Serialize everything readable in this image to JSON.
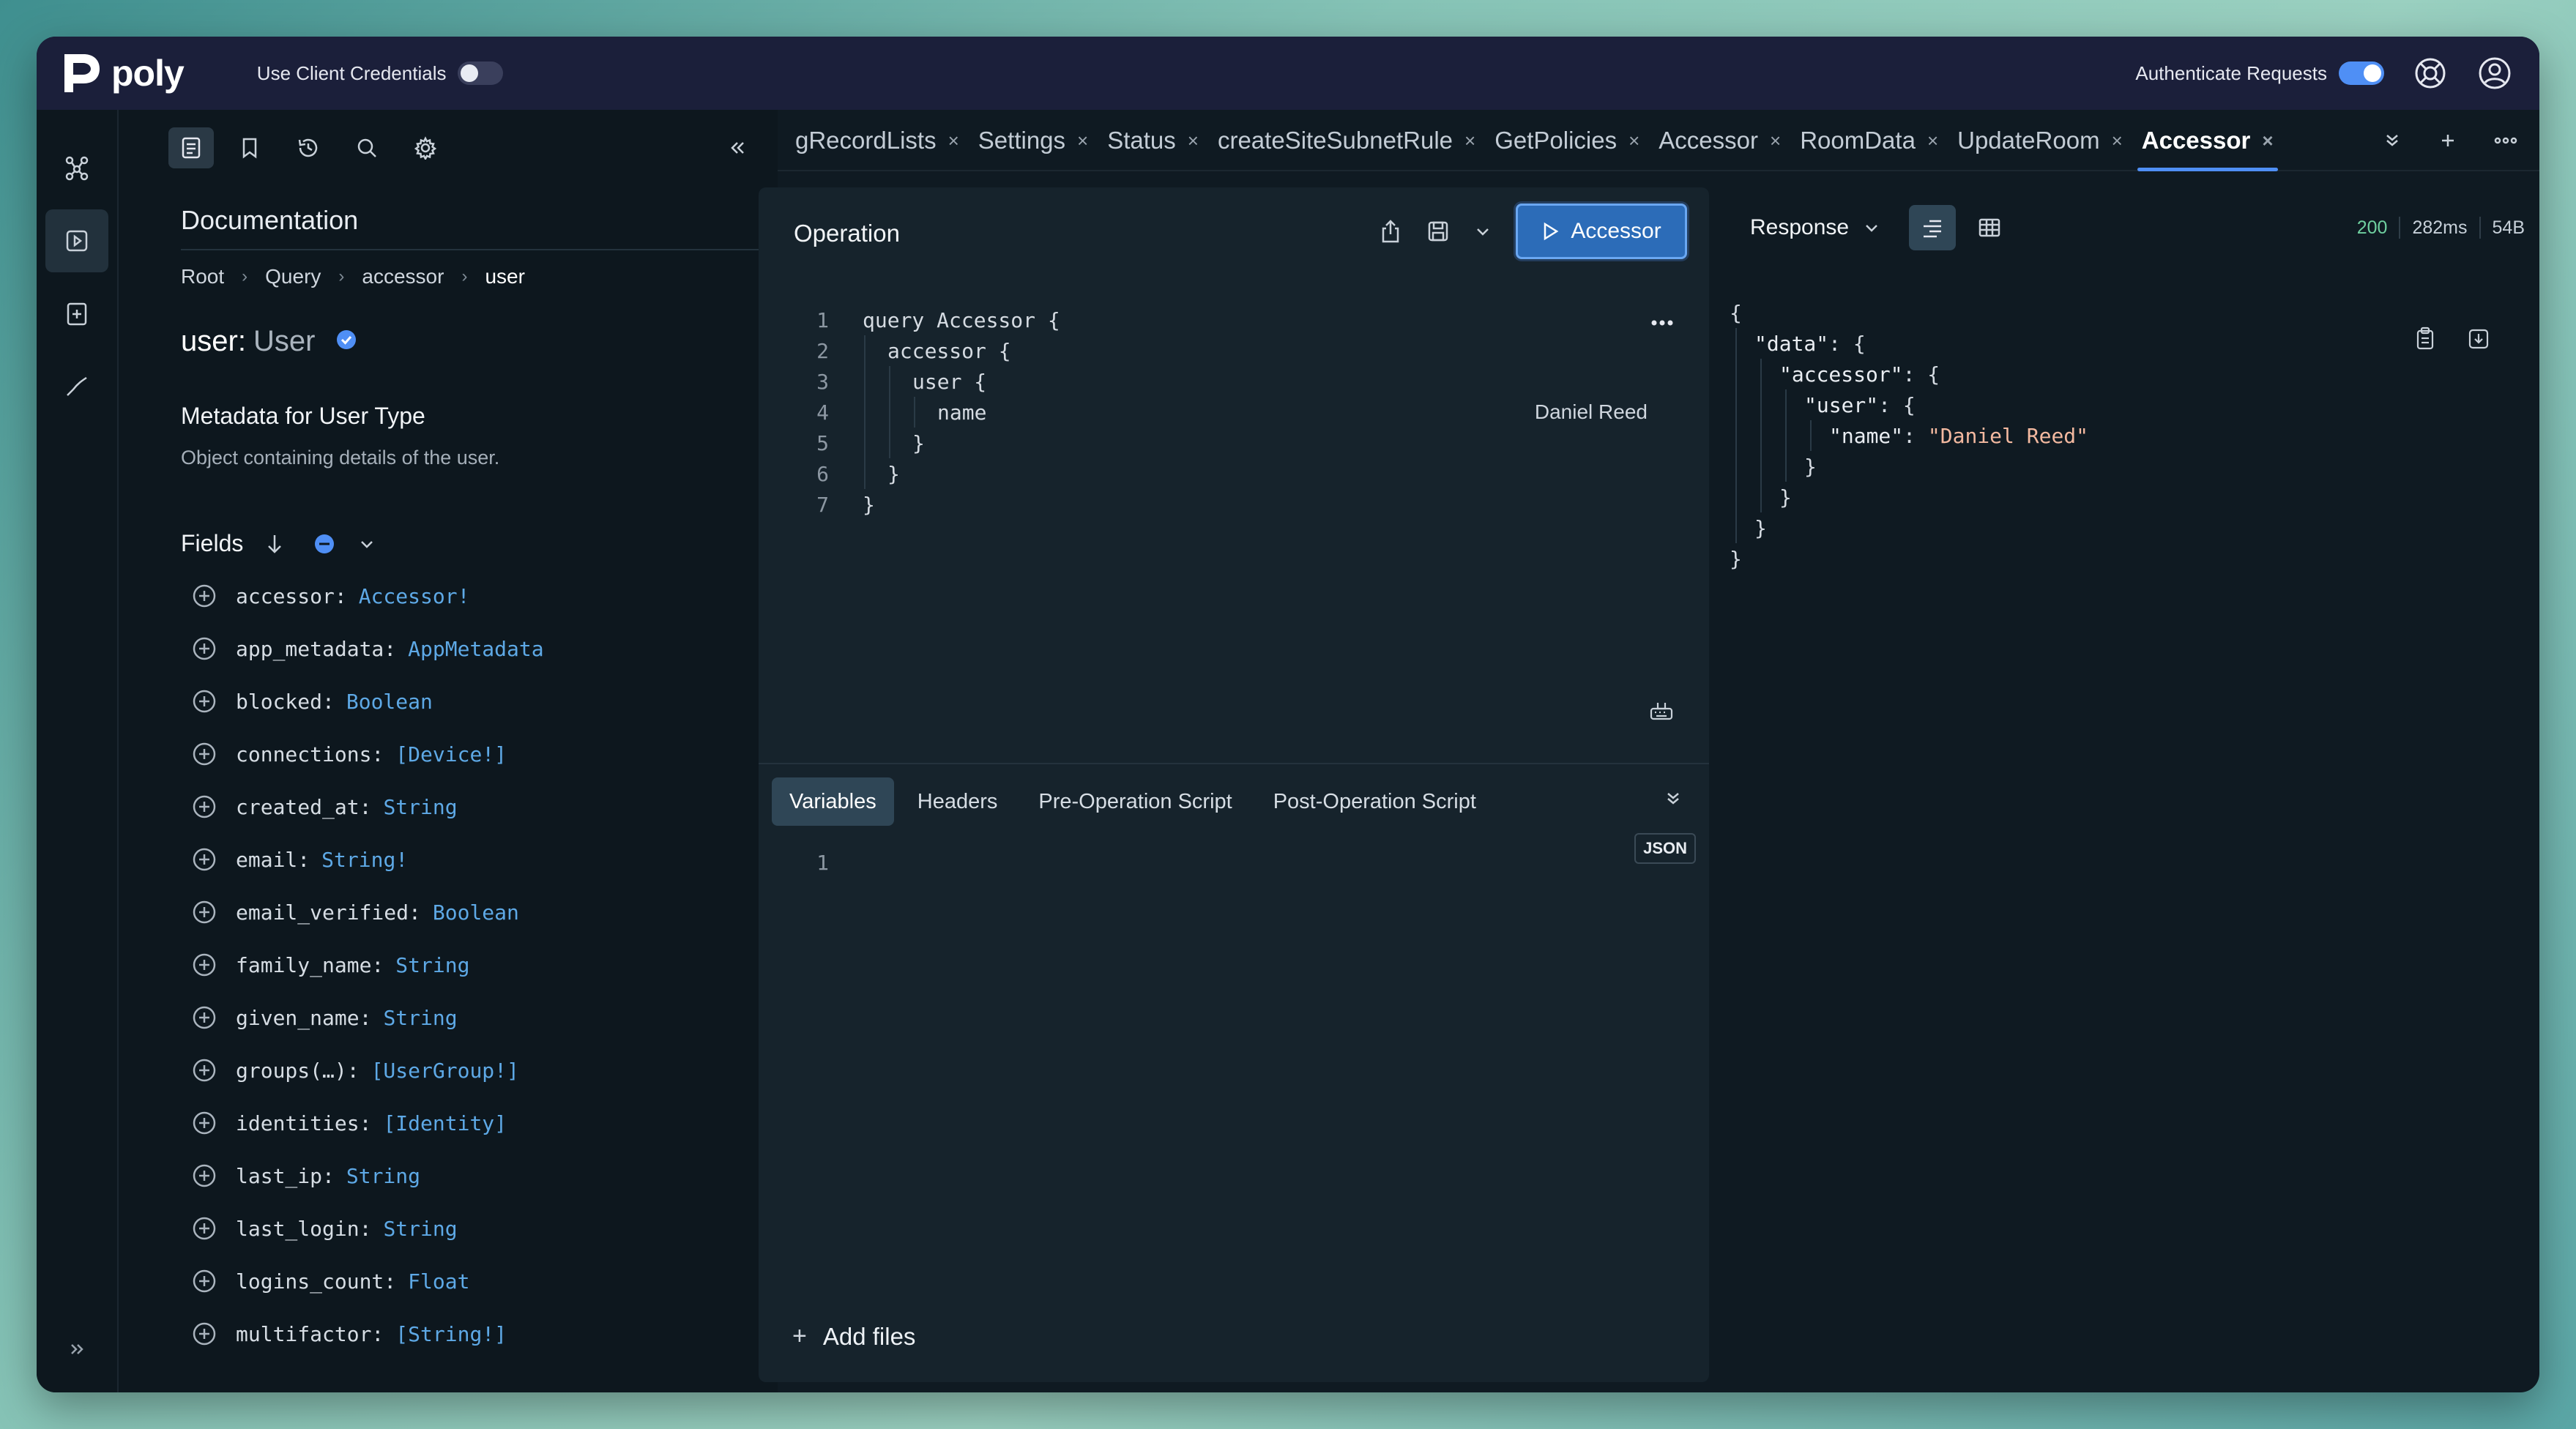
{
  "app": {
    "brand": "poly",
    "use_client_credentials_label": "Use Client Credentials",
    "use_client_credentials_on": false,
    "authenticate_requests_label": "Authenticate Requests",
    "authenticate_requests_on": true,
    "accent_color": "#4f8ff5"
  },
  "rail": {
    "icons": [
      "graph-icon",
      "run-icon",
      "add-document-icon",
      "check-icon"
    ],
    "expand_icon": "double-chevron-right-icon"
  },
  "docs": {
    "toolbar_icons": [
      "document-icon",
      "bookmark-icon",
      "history-icon",
      "search-icon",
      "gear-icon"
    ],
    "title": "Documentation",
    "breadcrumb": [
      "Root",
      "Query",
      "accessor",
      "user"
    ],
    "type_field": "user:",
    "type_name": "User",
    "metadata_title": "Metadata for User Type",
    "metadata_desc": "Object containing details of the user.",
    "fields_label": "Fields",
    "fields": [
      {
        "name": "accessor:",
        "type": "Accessor!"
      },
      {
        "name": "app_metadata:",
        "type": "AppMetadata"
      },
      {
        "name": "blocked:",
        "type": "Boolean"
      },
      {
        "name": "connections:",
        "type": "[Device!]"
      },
      {
        "name": "created_at:",
        "type": "String"
      },
      {
        "name": "email:",
        "type": "String!"
      },
      {
        "name": "email_verified:",
        "type": "Boolean"
      },
      {
        "name": "family_name:",
        "type": "String"
      },
      {
        "name": "given_name:",
        "type": "String"
      },
      {
        "name": "groups(…):",
        "type": "[UserGroup!]"
      },
      {
        "name": "identities:",
        "type": "[Identity]"
      },
      {
        "name": "last_ip:",
        "type": "String"
      },
      {
        "name": "last_login:",
        "type": "String"
      },
      {
        "name": "logins_count:",
        "type": "Float"
      },
      {
        "name": "multifactor:",
        "type": "[String!]"
      }
    ]
  },
  "tabs": [
    {
      "label": "gRecordLists",
      "active": false
    },
    {
      "label": "Settings",
      "active": false
    },
    {
      "label": "Status",
      "active": false
    },
    {
      "label": "createSiteSubnetRule",
      "active": false
    },
    {
      "label": "GetPolicies",
      "active": false
    },
    {
      "label": "Accessor",
      "active": false
    },
    {
      "label": "RoomData",
      "active": false
    },
    {
      "label": "UpdateRoom",
      "active": false
    },
    {
      "label": "Accessor",
      "active": true
    }
  ],
  "tab_close": "×",
  "operation": {
    "title": "Operation",
    "run_label": "Accessor",
    "code": [
      {
        "n": "1",
        "t": "query Accessor {"
      },
      {
        "n": "2",
        "t": "accessor {"
      },
      {
        "n": "3",
        "t": "user {"
      },
      {
        "n": "4",
        "t": "name"
      },
      {
        "n": "5",
        "t": "}"
      },
      {
        "n": "6",
        "t": "}"
      },
      {
        "n": "7",
        "t": "}"
      }
    ],
    "inline_hint": "Daniel Reed",
    "var_tabs": [
      "Variables",
      "Headers",
      "Pre-Operation Script",
      "Post-Operation Script"
    ],
    "active_var_tab": "Variables",
    "var_line": "1",
    "json_badge": "JSON",
    "add_files": "Add files"
  },
  "response": {
    "title": "Response",
    "status": "200",
    "time": "282ms",
    "size": "54B",
    "lines": [
      {
        "indent": 0,
        "k": "",
        "v": "{"
      },
      {
        "indent": 1,
        "k": "\"data\"",
        "v": ": {"
      },
      {
        "indent": 2,
        "k": "\"accessor\"",
        "v": ": {"
      },
      {
        "indent": 3,
        "k": "\"user\"",
        "v": ": {"
      },
      {
        "indent": 4,
        "k": "\"name\"",
        "v": ": ",
        "s": "\"Daniel Reed\""
      },
      {
        "indent": 3,
        "k": "",
        "v": "}"
      },
      {
        "indent": 2,
        "k": "",
        "v": "}"
      },
      {
        "indent": 1,
        "k": "",
        "v": "}"
      },
      {
        "indent": 0,
        "k": "",
        "v": "}"
      }
    ]
  }
}
